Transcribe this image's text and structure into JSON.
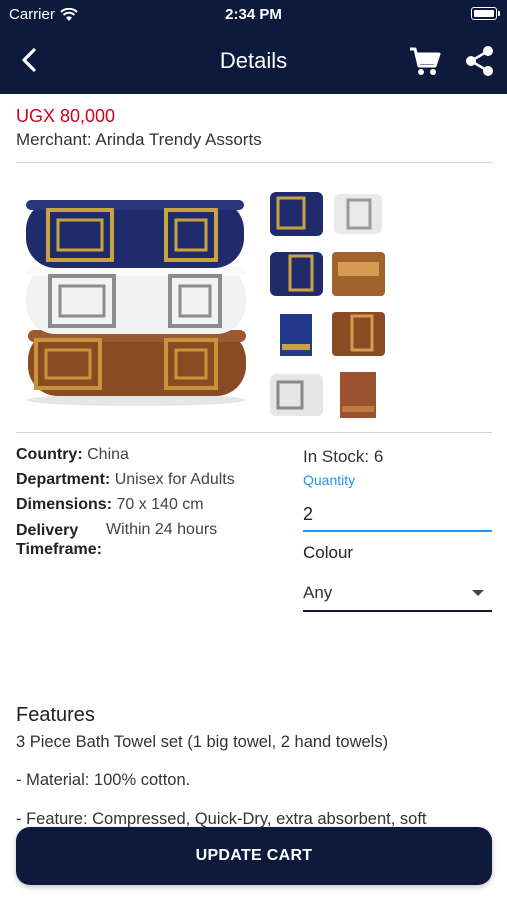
{
  "status_bar": {
    "carrier": "Carrier",
    "time": "2:34 PM"
  },
  "nav": {
    "title": "Details"
  },
  "product": {
    "price": "UGX 80,000",
    "merchant": "Merchant: Arinda Trendy Assorts"
  },
  "details": {
    "country_label": "Country:",
    "country_value": "China",
    "department_label": "Department:",
    "department_value": "Unisex for Adults",
    "dimensions_label": "Dimensions:",
    "dimensions_value": "70 x 140 cm",
    "delivery_label_1": "Delivery",
    "delivery_label_2": "Timeframe:",
    "delivery_value": "Within 24 hours"
  },
  "order": {
    "stock": "In Stock: 6",
    "quantity_label": "Quantity",
    "quantity_value": "2",
    "colour_label": "Colour",
    "colour_value": "Any"
  },
  "features": {
    "title": "Features",
    "lines": [
      "3 Piece Bath Towel set (1 big towel, 2 hand towels)",
      "- Material: 100% cotton.",
      "- Feature: Compressed, Quick-Dry, extra absorbent, soft"
    ]
  },
  "actions": {
    "update_cart": "UPDATE CART"
  },
  "colors": {
    "navy": "#0d1a3c",
    "price_red": "#d0021b",
    "accent_blue": "#2196f3"
  },
  "icons": [
    "wifi-icon",
    "battery-icon",
    "back-arrow-icon",
    "cart-icon",
    "share-icon",
    "dropdown-caret-icon"
  ]
}
